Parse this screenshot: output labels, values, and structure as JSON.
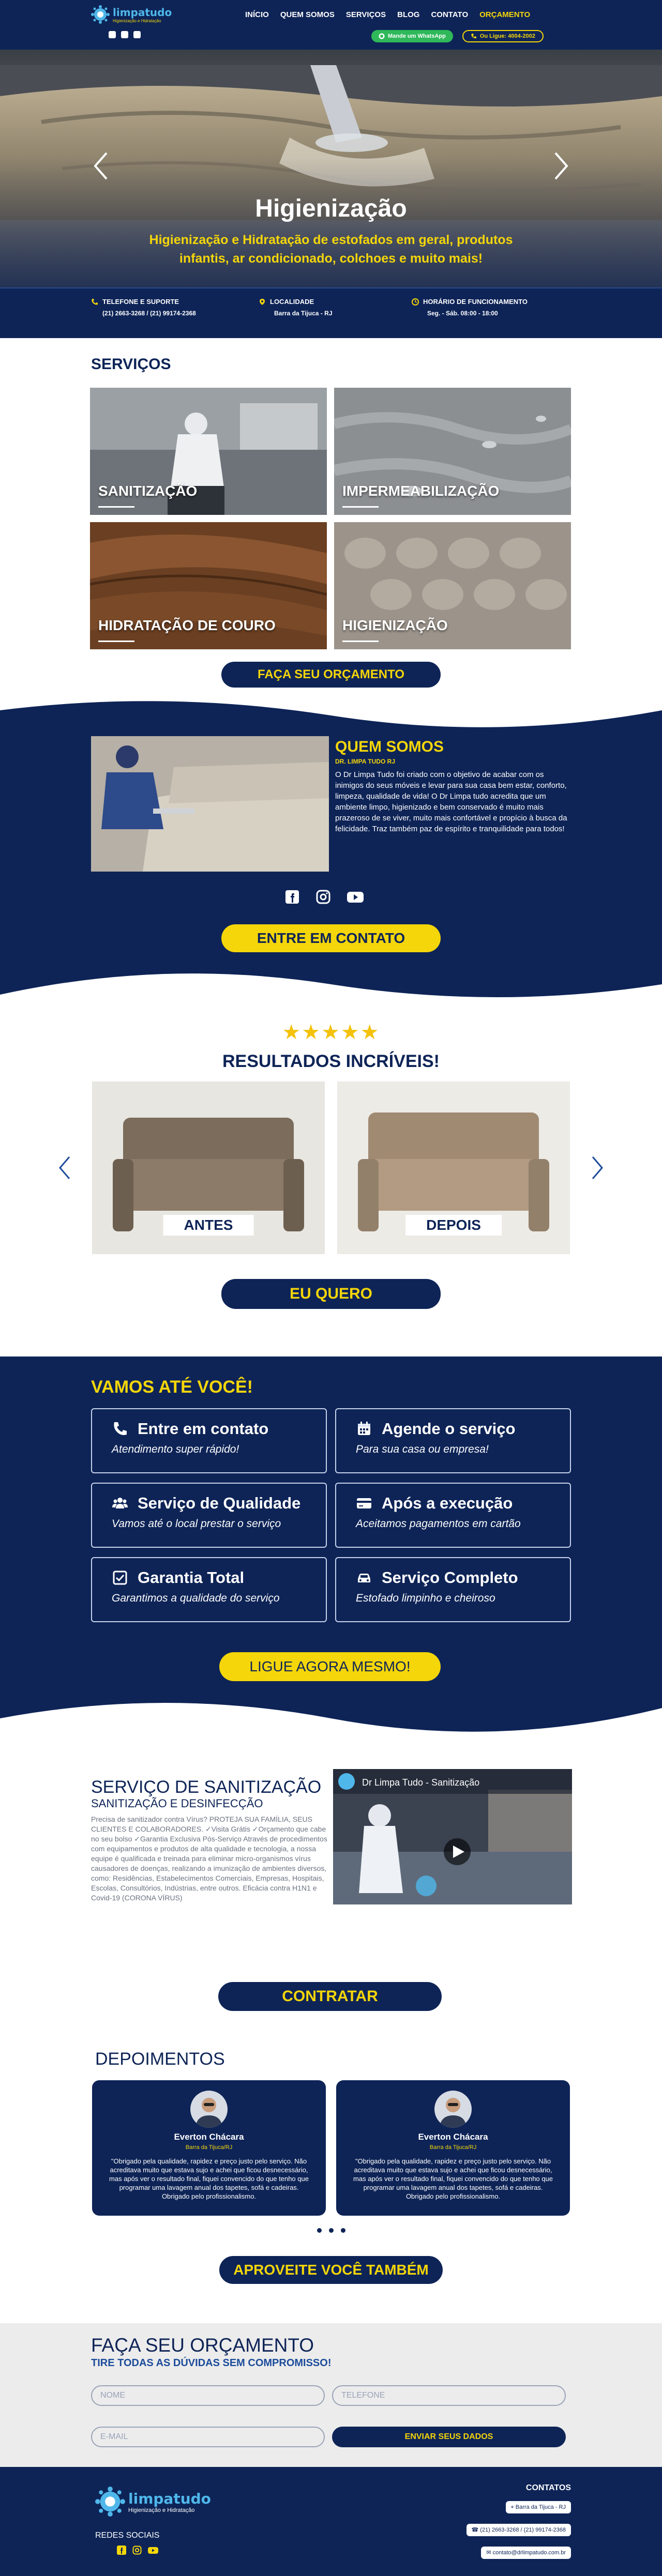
{
  "header": {
    "logo_name": "limpatudo",
    "logo_tag": "Higienização e Hidratação",
    "nav": [
      {
        "label": "INÍCIO"
      },
      {
        "label": "QUEM SOMOS"
      },
      {
        "label": "SERVIÇOS"
      },
      {
        "label": "BLOG"
      },
      {
        "label": "CONTATO"
      },
      {
        "label": "ORÇAMENTO"
      }
    ],
    "whatsapp_btn": "Mande um WhatsApp",
    "call_btn": "Ou Ligue: 4004-2002"
  },
  "hero": {
    "title": "Higienização",
    "subtitle": "Higienização e Hidratação de estofados em geral, produtos infantis, ar condicionado, colchoes e muito mais!"
  },
  "infobar": {
    "phone_label": "TELEFONE E SUPORTE",
    "phone_value": "(21) 2663-3268 / (21) 99174-2368",
    "location_label": "LOCALIDADE",
    "location_value": "Barra da Tijuca - RJ",
    "hours_label": "HORÁRIO DE FUNCIONAMENTO",
    "hours_value": "Seg. - Sáb. 08:00 - 18:00"
  },
  "services": {
    "title": "SERVIÇOS",
    "items": [
      {
        "label": "SANITIZAÇÃO"
      },
      {
        "label": "IMPERMEABILIZAÇÃO"
      },
      {
        "label": "HIDRATAÇÃO DE COURO"
      },
      {
        "label": "HIGIENIZAÇÃO"
      }
    ],
    "cta": "FAÇA SEU ORÇAMENTO"
  },
  "about": {
    "title": "QUEM SOMOS",
    "subtitle": "DR. LIMPA TUDO RJ",
    "text": "O Dr Limpa Tudo foi criado com o objetivo de acabar com os inimigos do seus móveis e levar para sua casa bem estar, conforto, limpeza, qualidade de vida! O Dr Limpa tudo acredita que um ambiente limpo, higienizado e bem conservado é muito mais prazeroso de se viver, muito mais confortável e propício à busca da felicidade. Traz também paz de espírito e tranquilidade para todos!",
    "cta": "ENTRE EM CONTATO"
  },
  "results": {
    "stars": "★★★★★",
    "title": "RESULTADOS INCRÍVEIS!",
    "before_label": "ANTES",
    "after_label": "DEPOIS",
    "cta": "EU QUERO"
  },
  "features": {
    "title": "VAMOS ATÉ VOCÊ!",
    "items": [
      {
        "title": "Entre em contato",
        "sub": "Atendimento super rápido!",
        "icon": "phone-icon"
      },
      {
        "title": "Agende o serviço",
        "sub": "Para sua casa ou empresa!",
        "icon": "calendar-icon"
      },
      {
        "title": "Serviço de Qualidade",
        "sub": "Vamos até o local prestar o serviço",
        "icon": "users-icon"
      },
      {
        "title": "Após a execução",
        "sub": "Aceitamos pagamentos em cartão",
        "icon": "credit-card-icon"
      },
      {
        "title": "Garantia Total",
        "sub": "Garantimos a qualidade do serviço",
        "icon": "checkbox-icon"
      },
      {
        "title": "Serviço Completo",
        "sub": "Estofado limpinho e cheiroso",
        "icon": "car-icon"
      }
    ],
    "cta": "LIGUE AGORA MESMO!"
  },
  "sanitization": {
    "title": "SERVIÇO DE SANITIZAÇÃO",
    "subtitle": "SANITIZAÇÃO E DESINFECÇÃO",
    "text": "Precisa de sanitizador contra Vírus? PROTEJA SUA FAMÍLIA, SEUS CLIENTES E COLABORADORES. ✓Visita Grátis ✓Orçamento que cabe no seu bolso ✓Garantia Exclusiva Pós-Serviço Através de procedimentos com equipamentos e produtos de alta qualidade e tecnologia, a nossa equipe é qualificada e treinada para eliminar micro-organismos vírus causadores de doenças, realizando a imunização de ambientes diversos, como: Residências, Estabelecimentos Comerciais, Empresas, Hospitais, Escolas, Consultórios, Indústrias, entre outros. Eficácia contra H1N1 e Covid-19 (CORONA VÍRUS)",
    "video_title": "Dr Limpa Tudo - Sanitização",
    "cta": "CONTRATAR"
  },
  "testimonials": {
    "title": "DEPOIMENTOS",
    "items": [
      {
        "name": "Everton Chácara",
        "location": "Barra da Tijuca/RJ",
        "text": "\"Obrigado pela qualidade, rapidez e preço justo pelo serviço. Não acreditava muito que estava sujo e achei que ficou desnecessário, mas após ver o resultado final, fiquei  convencido do que tenho que programar uma lavagem anual dos tapetes, sofá e cadeiras. Obrigado pelo profissionalismo."
      },
      {
        "name": "Everton Chácara",
        "location": "Barra da Tijuca/RJ",
        "text": "\"Obrigado pela qualidade, rapidez e preço justo pelo serviço. Não acreditava muito que estava sujo e achei que ficou desnecessário, mas após ver o resultado final, fiquei  convencido do que tenho que programar uma lavagem anual dos tapetes, sofá e cadeiras. Obrigado pelo profissionalismo."
      }
    ],
    "cta": "APROVEITE VOCÊ TAMBÉM"
  },
  "quote": {
    "title": "FAÇA SEU ORÇAMENTO",
    "subtitle": "TIRE TODAS AS DÚVIDAS SEM COMPROMISSO!",
    "name_placeholder": "NOME",
    "phone_placeholder": "TELEFONE",
    "email_placeholder": "E-MAIL",
    "submit": "ENVIAR SEUS DADOS"
  },
  "footer": {
    "logo_name": "limpatudo",
    "logo_tag": "Higienização e Hidratação",
    "redes": "REDES SOCIAIS",
    "contatos": "CONTATOS",
    "location": "Barra da Tijuca - RJ",
    "phone": "(21) 2663-3268 / (21) 99174-2368",
    "email": "contato@drlimpatudo.com.br"
  },
  "colors": {
    "navy": "#0e2457",
    "yellow": "#f4d60a",
    "green": "#2fb85a",
    "brand_blue": "#4fb7ea"
  }
}
